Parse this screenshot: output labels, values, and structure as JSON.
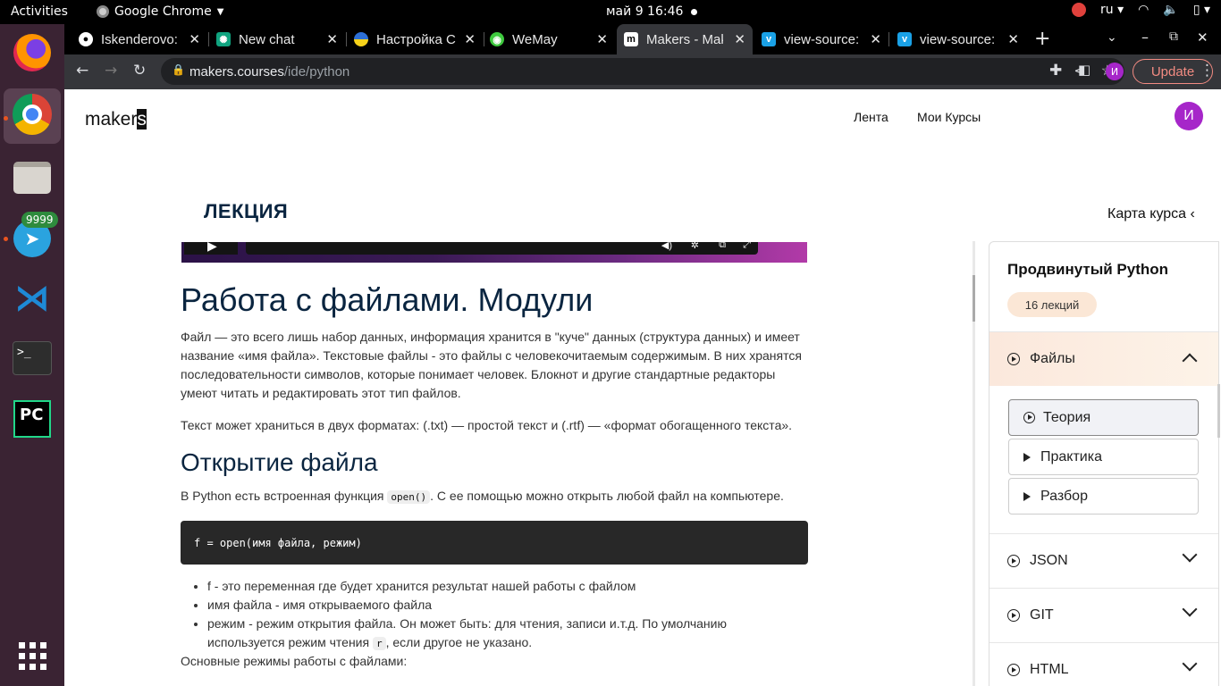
{
  "system": {
    "activities": "Activities",
    "app_name": "Google Chrome",
    "clock": "май 9  16:46",
    "lang": "ru"
  },
  "dock": {
    "telegram_badge": "9999",
    "items": [
      "firefox-icon",
      "chrome-icon",
      "files-icon",
      "telegram-icon",
      "vscode-icon",
      "terminal-icon",
      "pycharm-icon",
      "app-grid-icon"
    ]
  },
  "tabs": [
    {
      "title": "Iskenderovo:",
      "icon": "github-icon"
    },
    {
      "title": "New chat",
      "icon": "openai-icon"
    },
    {
      "title": "Настройка С",
      "icon": "ukraine-icon"
    },
    {
      "title": "WeMay",
      "icon": "wemay-icon"
    },
    {
      "title": "Makers - Mak",
      "icon": "makers-icon"
    },
    {
      "title": "view-source:",
      "icon": "vue-icon"
    },
    {
      "title": "view-source:",
      "icon": "vue-icon"
    }
  ],
  "address": {
    "host": "makers.courses",
    "path": "/ide/python"
  },
  "toolbar": {
    "update": "Update",
    "profile_initial": "И"
  },
  "site": {
    "logo": "maker",
    "logo_cursor": "s",
    "nav": [
      "Лента",
      "Мои Курсы"
    ],
    "avatar_initial": "И"
  },
  "lecture": {
    "label": "ЛЕКЦИЯ",
    "course_map": "Карта курса",
    "h1": "Работа с файлами. Модули",
    "p1": "Файл — это всего лишь набор данных, информация хранится в \"куче\" данных (структура данных) и имеет название «имя файла». Текстовые файлы - это файлы с человекочитаемым содержимым. В них хранятся последовательности символов, которые понимает человек. Блокнот и другие стандартные редакторы умеют читать и редактировать этот тип файлов.",
    "p2": "Текст может храниться в двух форматах: (.txt) — простой текст и (.rtf) — «формат обогащенного текста».",
    "h2": "Открытие файла",
    "p3a": "В Python есть встроенная функция ",
    "p3code": "open()",
    "p3b": ". С ее помощью можно открыть любой файл на компьютере.",
    "code": "f = open(имя файла, режим)",
    "li1": "f - это переменная где будет хранится результат нашей работы с файлом",
    "li2": "имя файла - имя открываемого файла",
    "li3a": "режим - режим открытия файла. Он может быть: для чтения, записи и.т.д. По умолчанию используется режим чтения ",
    "li3code": "r",
    "li3b": ", если другое не указано.",
    "p4": "Основные режимы работы с файлами:"
  },
  "sidebar": {
    "title": "Продвинутый Python",
    "badge": "16 лекций",
    "sections": [
      "Файлы",
      "JSON",
      "GIT",
      "HTML"
    ],
    "items": [
      "Теория",
      "Практика",
      "Разбор"
    ]
  }
}
